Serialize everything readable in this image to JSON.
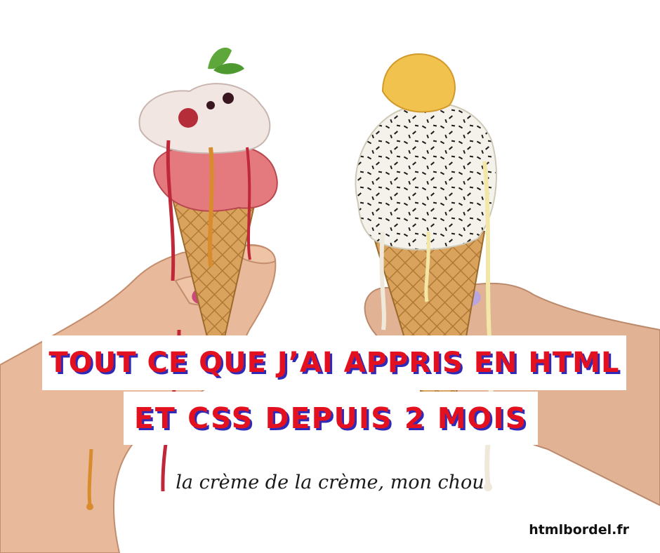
{
  "headline": {
    "line1": "TOUT CE QUE J’AI APPRIS EN HTML",
    "line2": "ET CSS DEPUIS 2 MOIS"
  },
  "tagline": "la crème de la crème, mon chou",
  "site": "htmlbordel.fr",
  "colors": {
    "headline_red": "#e3111f",
    "headline_shadow_blue": "#2f2bb8",
    "band_white": "#ffffff"
  }
}
